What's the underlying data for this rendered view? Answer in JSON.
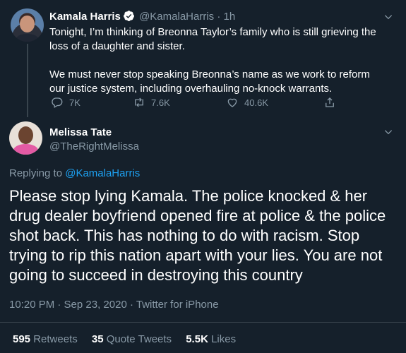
{
  "parent_tweet": {
    "author_name": "Kamala Harris",
    "handle": "@KamalaHarris",
    "separator": "·",
    "time": "1h",
    "paragraphs": [
      "Tonight, I’m thinking of Breonna Taylor’s family who is still grieving the loss of a daughter and sister.",
      "We must never stop speaking Breonna’s name as we work to reform our justice system, including overhauling no-knock warrants."
    ],
    "reply_count": "7K",
    "retweet_count": "7.6K",
    "like_count": "40.6K",
    "icons": [
      "reply-icon",
      "retweet-icon",
      "like-icon",
      "share-icon"
    ]
  },
  "reply_tweet": {
    "author_name": "Melissa Tate",
    "handle": "@TheRightMelissa",
    "replying_prefix": "Replying to",
    "replying_to": "@KamalaHarris",
    "text": "Please stop lying Kamala. The police knocked & her drug dealer boyfriend opened fire at police & the police shot back. This has nothing to do with racism. Stop trying to rip this nation apart with your lies. You are not going to succeed in destroying this country",
    "meta": "10:20 PM · Sep 23, 2020 · Twitter for iPhone",
    "retweets_count": "595",
    "retweets_label": "Retweets",
    "quote_count": "35",
    "quote_label": "Quote Tweets",
    "likes_count": "5.5K",
    "likes_label": "Likes"
  },
  "colors": {
    "background": "#15202b",
    "text": "#ffffff",
    "muted": "#8899a6",
    "link": "#1da1f2",
    "divider": "#38444d"
  }
}
